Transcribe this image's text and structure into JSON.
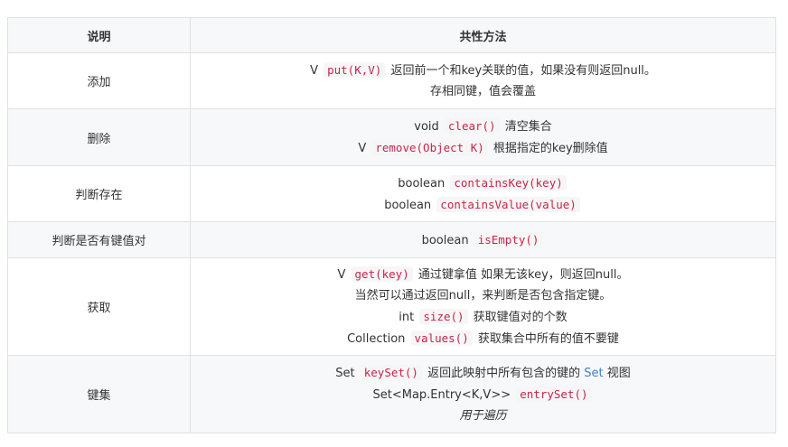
{
  "header": {
    "col1": "说明",
    "col2": "共性方法"
  },
  "rows": [
    {
      "label": "添加",
      "lines": [
        {
          "pre": "V ",
          "code": "put(K,V)",
          "post": " 返回前一个和key关联的值，如果没有则返回null。"
        },
        {
          "pre": "存相同键，值会覆盖"
        }
      ]
    },
    {
      "label": "删除",
      "lines": [
        {
          "pre": "void ",
          "code": "clear()",
          "post": " 清空集合"
        },
        {
          "pre": "V ",
          "code": "remove(Object K)",
          "post": " 根据指定的key删除值"
        }
      ]
    },
    {
      "label": "判断存在",
      "lines": [
        {
          "pre": "boolean ",
          "code": "containsKey(key)"
        },
        {
          "pre": "boolean ",
          "code": "containsValue(value)"
        }
      ]
    },
    {
      "label": "判断是否有键值对",
      "lines": [
        {
          "pre": "boolean ",
          "code": "isEmpty()"
        }
      ]
    },
    {
      "label": "获取",
      "lines": [
        {
          "pre": "V ",
          "code": "get(key)",
          "post": " 通过键拿值 如果无该key，则返回null。"
        },
        {
          "pre": "当然可以通过返回null，来判断是否包含指定键。"
        },
        {
          "pre": "int ",
          "code": "size()",
          "post": " 获取键值对的个数"
        },
        {
          "pre": "Collection ",
          "code": "values()",
          "post": " 获取集合中所有的值不要键"
        }
      ]
    },
    {
      "label": "键集",
      "lines": [
        {
          "pre": "Set ",
          "code": "keySet()",
          "post": " 返回此映射中所有包含的键的 ",
          "link": "Set",
          "post2": " 视图"
        },
        {
          "pre": "Set<Map.Entry<K,V>> ",
          "code": "entrySet()"
        },
        {
          "em": "用于遍历"
        }
      ]
    }
  ]
}
